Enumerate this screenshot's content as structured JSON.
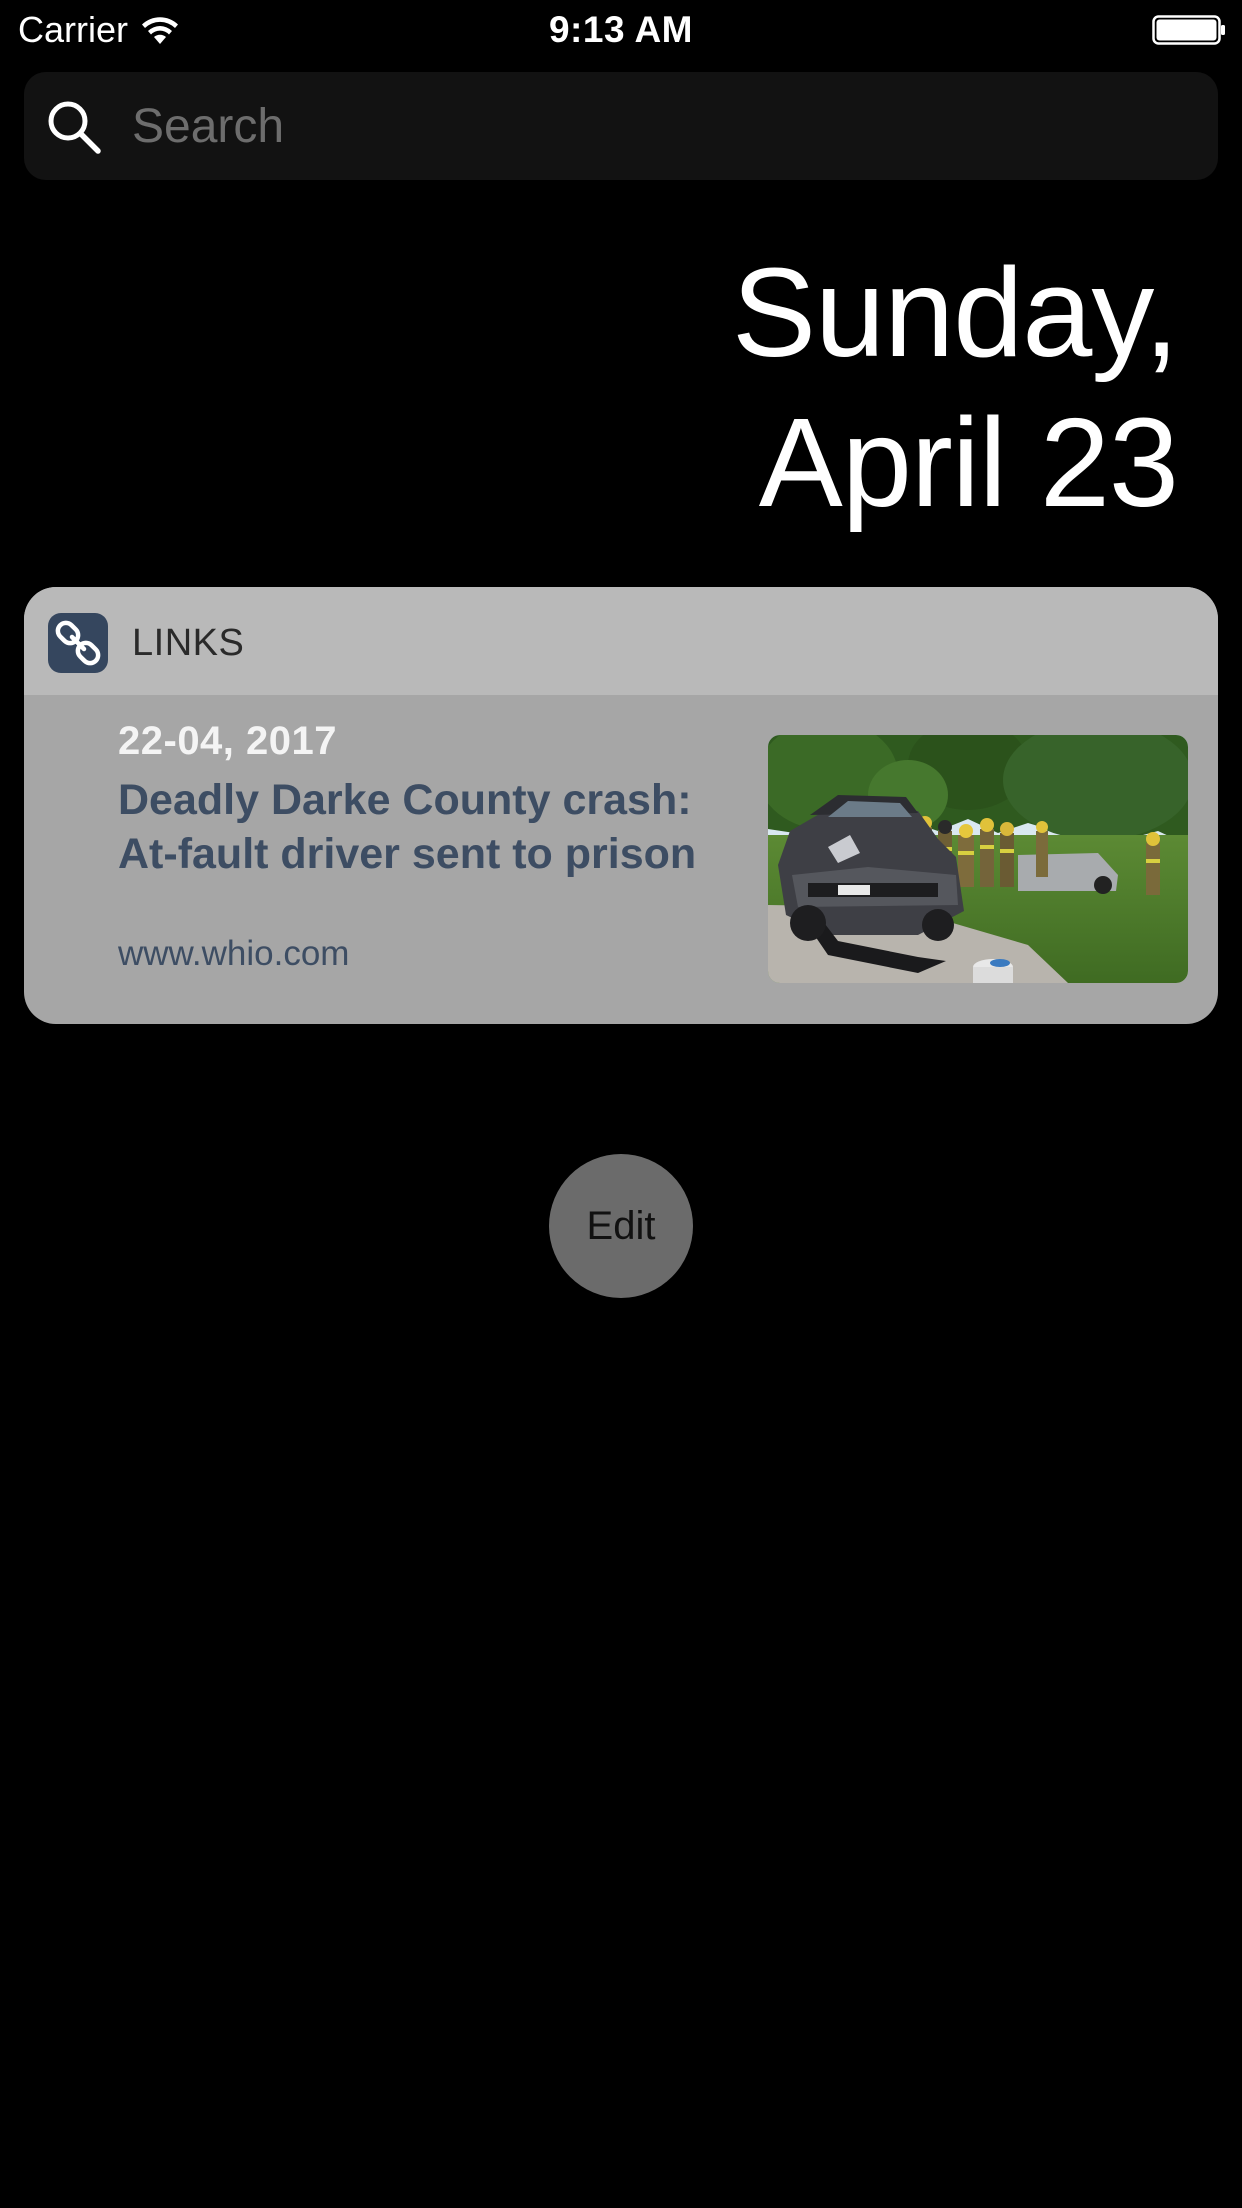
{
  "status_bar": {
    "carrier": "Carrier",
    "time": "9:13 AM",
    "wifi_icon": "wifi-icon",
    "battery_icon": "battery-icon",
    "battery_level": 1.0
  },
  "search": {
    "placeholder": "Search",
    "value": "",
    "icon": "search-icon"
  },
  "date": {
    "line1": "Sunday,",
    "line2": "April 23"
  },
  "widget": {
    "title": "LINKS",
    "icon": "link-chain-icon",
    "items": [
      {
        "date": "22-04, 2017",
        "title": "Deadly Darke County crash: At-fault driver sent to prison",
        "domain": "www.whio.com",
        "thumbnail": "crash-scene-photo"
      }
    ]
  },
  "edit_button": {
    "label": "Edit"
  },
  "colors": {
    "background": "#000000",
    "widget_body": "#a6a6a6",
    "widget_header": "#b9b9b9",
    "link_title": "#3d4d63",
    "app_icon": "#35465e",
    "edit_button": "#6b6b6b"
  }
}
